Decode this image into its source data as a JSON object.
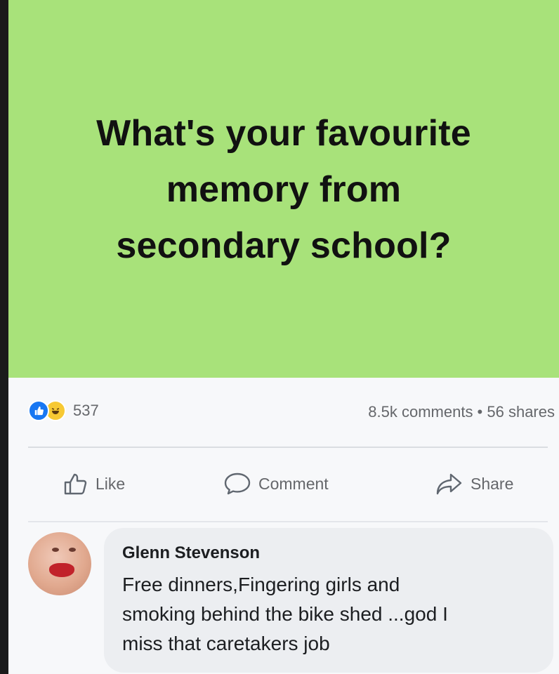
{
  "post": {
    "background_color": "#a8e27a",
    "text_lines": [
      "What's your favourite",
      "memory from",
      "secondary school?"
    ]
  },
  "stats": {
    "reaction_icons": [
      "like-icon",
      "haha-icon"
    ],
    "reaction_count": "537",
    "counts_text": "8.5k comments • 56 shares"
  },
  "actions": {
    "like_label": "Like",
    "comment_label": "Comment",
    "share_label": "Share"
  },
  "comment": {
    "author": "Glenn Stevenson",
    "text_lines": [
      "Free dinners,Fingering girls and",
      "smoking behind the bike shed ...god I",
      "miss that caretakers job"
    ]
  },
  "colors": {
    "accent": "#1877f2",
    "muted_text": "#65676b"
  }
}
